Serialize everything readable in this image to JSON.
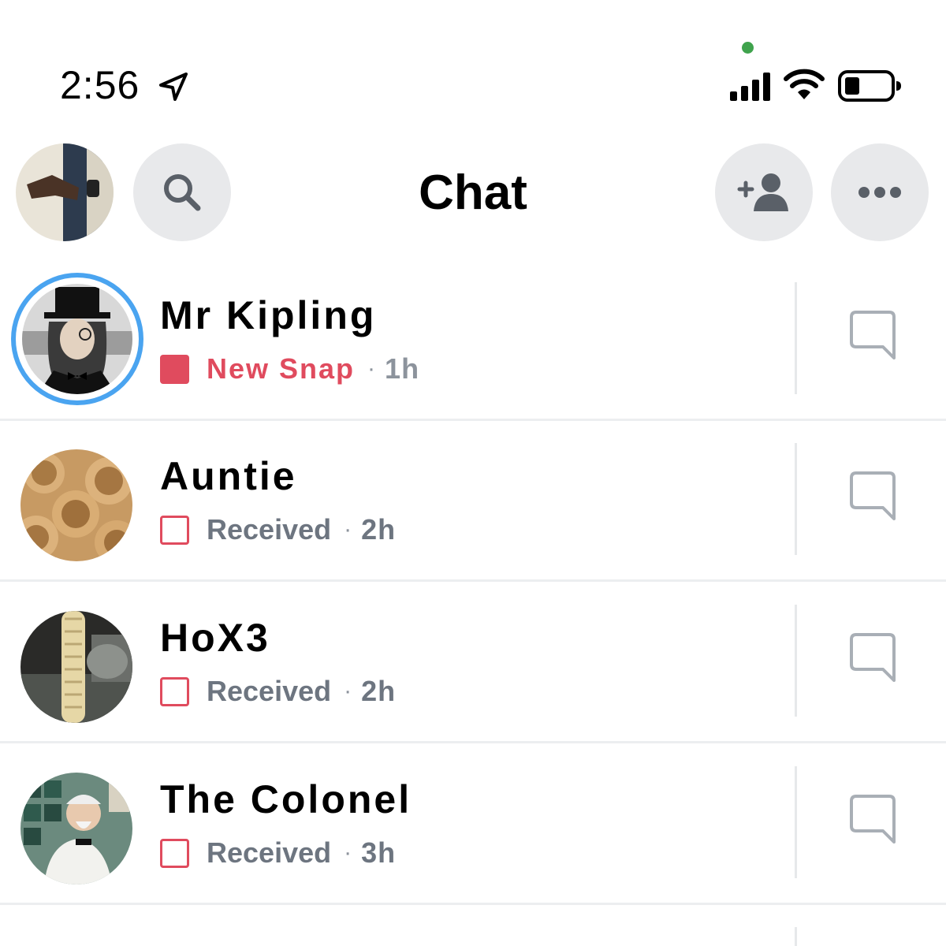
{
  "status_bar": {
    "time": "2:56",
    "icons": [
      "location-arrow-icon",
      "signal-icon",
      "wifi-icon",
      "battery-icon"
    ],
    "indicator_color": "#3fa34d"
  },
  "header": {
    "title": "Chat",
    "buttons": [
      "search-icon",
      "add-friend-icon",
      "more-icon"
    ]
  },
  "colors": {
    "accent_red": "#e04b5e",
    "story_ring_blue": "#4aa4f0",
    "button_gray": "#e8e9eb",
    "meta_gray": "#6d7580"
  },
  "chats": [
    {
      "name": "Mr Kipling",
      "status": "New Snap",
      "time": "1h",
      "unread": true,
      "has_story": true
    },
    {
      "name": "Auntie",
      "status": "Received",
      "time": "2h",
      "unread": false,
      "has_story": false
    },
    {
      "name": "HoX3",
      "status": "Received",
      "time": "2h",
      "unread": false,
      "has_story": false
    },
    {
      "name": "The Colonel",
      "status": "Received",
      "time": "3h",
      "unread": false,
      "has_story": false
    }
  ]
}
